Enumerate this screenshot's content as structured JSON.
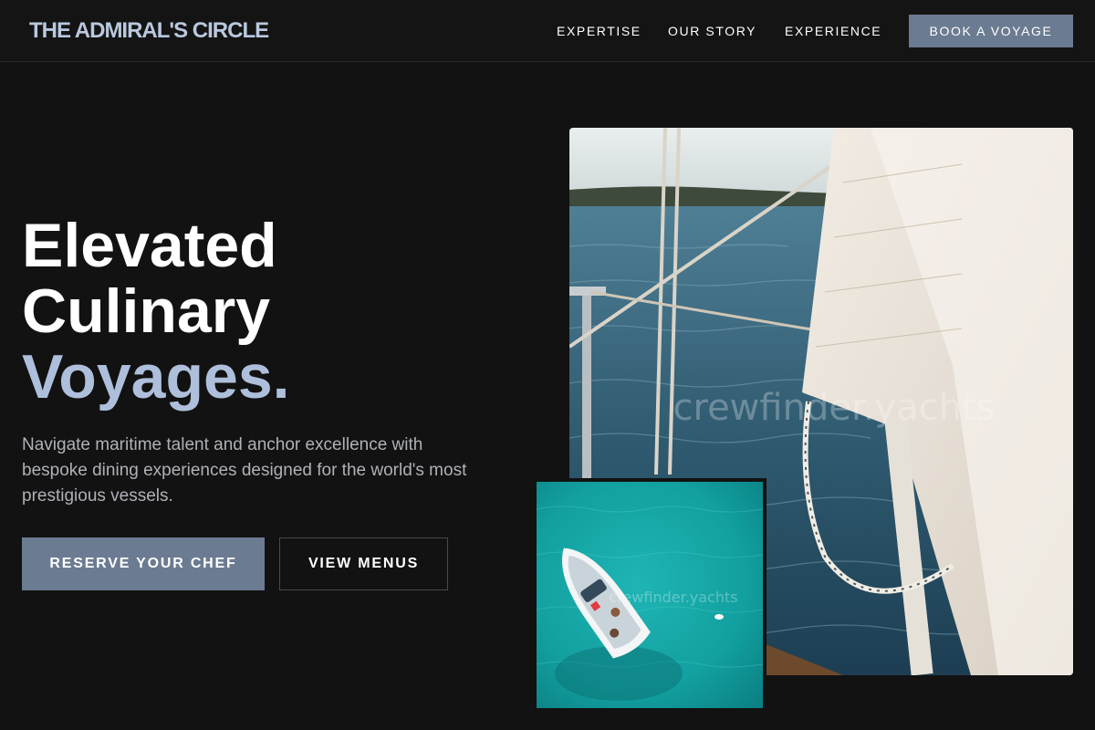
{
  "header": {
    "brand": "THE ADMIRAL'S CIRCLE",
    "nav": {
      "expertise": "EXPERTISE",
      "our_story": "OUR STORY",
      "experience": "EXPERIENCE"
    },
    "cta": "BOOK A VOYAGE"
  },
  "hero": {
    "title_line1": "Elevated",
    "title_line2": "Culinary",
    "title_line3": "Voyages.",
    "description": "Navigate maritime talent and anchor excellence with bespoke dining experiences designed for the world's most prestigious vessels.",
    "primary_button": "RESERVE YOUR CHEF",
    "secondary_button": "VIEW MENUS"
  },
  "images": {
    "main_watermark": "crewfinder.yachts",
    "inset_watermark": "crewfinder.yachts"
  },
  "colors": {
    "background": "#121212",
    "accent": "#aebfdc",
    "button": "#6b7b92",
    "body_text": "#aeb1b7"
  }
}
